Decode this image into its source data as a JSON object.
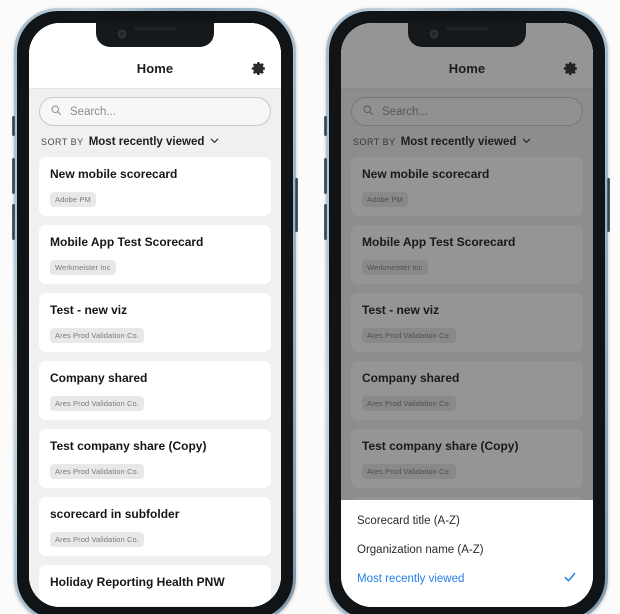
{
  "app": {
    "nav_title": "Home",
    "gear_icon": "gear-icon",
    "search": {
      "placeholder": "Search...",
      "value": "",
      "icon": "search-icon"
    },
    "sort": {
      "label": "SORT BY",
      "value": "Most recently viewed",
      "chevron_icon": "chevron-down-icon"
    },
    "cards": [
      {
        "title": "New mobile scorecard",
        "org": "Adobe PM"
      },
      {
        "title": "Mobile App Test Scorecard",
        "org": "Werkmeister Inc"
      },
      {
        "title": "Test - new viz",
        "org": "Ares Prod Validation Co."
      },
      {
        "title": "Company shared",
        "org": "Ares Prod Validation Co."
      },
      {
        "title": "Test company share (Copy)",
        "org": "Ares Prod Validation Co."
      },
      {
        "title": "scorecard in subfolder",
        "org": "Ares Prod Validation Co."
      },
      {
        "title": "Holiday Reporting Health PNW",
        "org": ""
      }
    ]
  },
  "sheet": {
    "options": [
      {
        "label": "Scorecard title (A-Z)",
        "selected": false
      },
      {
        "label": "Organization name (A-Z)",
        "selected": false
      },
      {
        "label": "Most recently viewed",
        "selected": true
      }
    ],
    "check_icon": "check-icon"
  },
  "colors": {
    "accent_blue": "#2680eb",
    "page_bg": "#f0f0f0",
    "card_bg": "#ffffff",
    "badge_bg": "#e8e8e8",
    "frame_rim": "#a8bfd0",
    "bezel": "#111416",
    "dim_overlay": "rgba(30,30,30,0.47)"
  }
}
